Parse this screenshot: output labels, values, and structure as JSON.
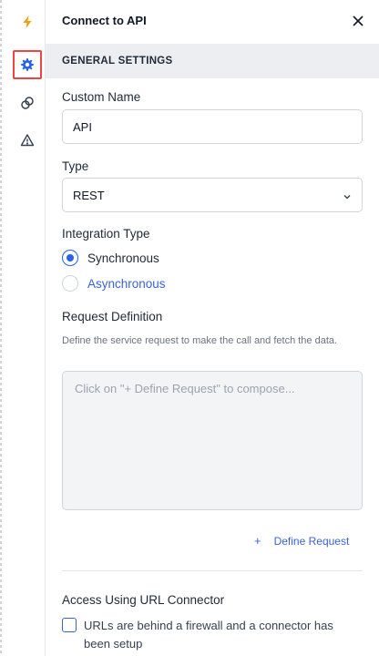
{
  "header": {
    "title": "Connect to API"
  },
  "rail": {
    "icons": [
      "lightning-icon",
      "gear-icon",
      "link-icon",
      "warning-icon"
    ],
    "accent": "#f59e0b",
    "active_color": "#2563eb"
  },
  "section": {
    "title": "GENERAL SETTINGS"
  },
  "form": {
    "custom_name_label": "Custom Name",
    "custom_name_value": "API",
    "type_label": "Type",
    "type_value": "REST",
    "integration_type_label": "Integration Type",
    "integration_options": [
      "Synchronous",
      "Asynchronous"
    ],
    "integration_selected": "Synchronous",
    "request_definition_label": "Request Definition",
    "request_definition_help": "Define the service request to make the call and fetch the data.",
    "request_placeholder": "Click on \"+ Define Request\" to compose...",
    "define_request_plus": "+",
    "define_request_label": "Define Request",
    "access_label": "Access Using URL Connector",
    "firewall_checkbox_label": "URLs are behind a firewall and a connector has been setup",
    "firewall_checked": false
  }
}
